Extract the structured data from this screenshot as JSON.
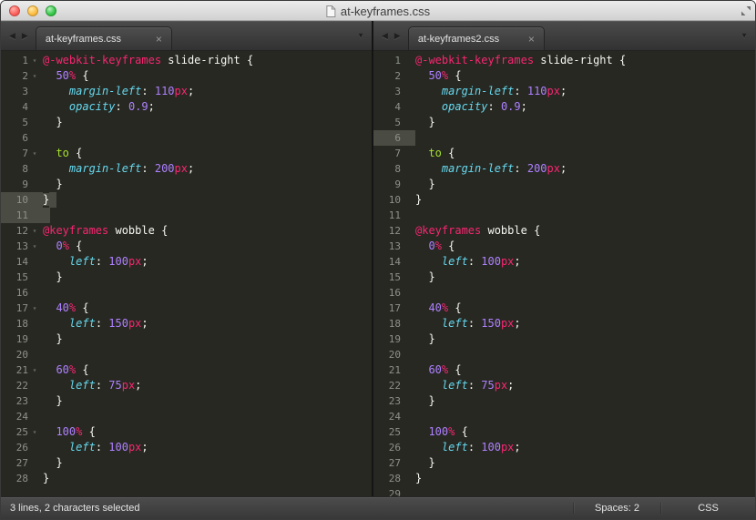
{
  "window": {
    "title": "at-keyframes.css"
  },
  "icons": {
    "tab_scroll_left": "◀",
    "tab_scroll_right": "▶",
    "tab_dropdown": "▼",
    "fold": "▾"
  },
  "colors": {
    "editor_background": "#272822",
    "foreground": "#f8f8f2",
    "at_rule_pink": "#f92672",
    "property_blue": "#66d9ef",
    "number_purple": "#ae81ff",
    "keyword_green": "#a6e22e",
    "gutter_gray": "#8f908a",
    "selection_gray": "#4a4b42"
  },
  "status_bar": {
    "selection_info": "3 lines, 2 characters selected",
    "indent": "Spaces: 2",
    "syntax": "CSS"
  },
  "panes": [
    {
      "tab": {
        "label": "at-keyframes.css",
        "close": "×"
      },
      "lines": [
        {
          "n": 1,
          "fold": true,
          "t": [
            [
              "at",
              "@-webkit-keyframes"
            ],
            [
              "plain",
              " "
            ],
            [
              "name",
              "slide-right"
            ],
            [
              "plain",
              " {"
            ]
          ]
        },
        {
          "n": 2,
          "fold": true,
          "t": [
            [
              "plain",
              "  "
            ],
            [
              "num",
              "50"
            ],
            [
              "unit",
              "%"
            ],
            [
              "plain",
              " {"
            ]
          ]
        },
        {
          "n": 3,
          "t": [
            [
              "plain",
              "    "
            ],
            [
              "prop",
              "margin-left"
            ],
            [
              "plain",
              ": "
            ],
            [
              "num",
              "110"
            ],
            [
              "unit",
              "px"
            ],
            [
              "plain",
              ";"
            ]
          ]
        },
        {
          "n": 4,
          "t": [
            [
              "plain",
              "    "
            ],
            [
              "prop",
              "opacity"
            ],
            [
              "plain",
              ": "
            ],
            [
              "num",
              "0.9"
            ],
            [
              "plain",
              ";"
            ]
          ]
        },
        {
          "n": 5,
          "t": [
            [
              "plain",
              "  }"
            ]
          ]
        },
        {
          "n": 6,
          "t": []
        },
        {
          "n": 7,
          "fold": true,
          "t": [
            [
              "plain",
              "  "
            ],
            [
              "kw",
              "to"
            ],
            [
              "plain",
              " {"
            ]
          ]
        },
        {
          "n": 8,
          "t": [
            [
              "plain",
              "    "
            ],
            [
              "prop",
              "margin-left"
            ],
            [
              "plain",
              ": "
            ],
            [
              "num",
              "200"
            ],
            [
              "unit",
              "px"
            ],
            [
              "plain",
              ";"
            ]
          ]
        },
        {
          "n": 9,
          "t": [
            [
              "plain",
              "  }"
            ]
          ]
        },
        {
          "n": 10,
          "ghl": true,
          "t": [
            [
              "sel",
              "}"
            ],
            [
              "selpad",
              ""
            ]
          ]
        },
        {
          "n": 11,
          "ghl": true,
          "t": [
            [
              "selpad",
              ""
            ]
          ]
        },
        {
          "n": 12,
          "fold": true,
          "t": [
            [
              "at",
              "@keyframes"
            ],
            [
              "plain",
              " "
            ],
            [
              "name",
              "wobble"
            ],
            [
              "plain",
              " {"
            ]
          ]
        },
        {
          "n": 13,
          "fold": true,
          "t": [
            [
              "plain",
              "  "
            ],
            [
              "num",
              "0"
            ],
            [
              "unit",
              "%"
            ],
            [
              "plain",
              " {"
            ]
          ]
        },
        {
          "n": 14,
          "t": [
            [
              "plain",
              "    "
            ],
            [
              "prop",
              "left"
            ],
            [
              "plain",
              ": "
            ],
            [
              "num",
              "100"
            ],
            [
              "unit",
              "px"
            ],
            [
              "plain",
              ";"
            ]
          ]
        },
        {
          "n": 15,
          "t": [
            [
              "plain",
              "  }"
            ]
          ]
        },
        {
          "n": 16,
          "t": []
        },
        {
          "n": 17,
          "fold": true,
          "t": [
            [
              "plain",
              "  "
            ],
            [
              "num",
              "40"
            ],
            [
              "unit",
              "%"
            ],
            [
              "plain",
              " {"
            ]
          ]
        },
        {
          "n": 18,
          "t": [
            [
              "plain",
              "    "
            ],
            [
              "prop",
              "left"
            ],
            [
              "plain",
              ": "
            ],
            [
              "num",
              "150"
            ],
            [
              "unit",
              "px"
            ],
            [
              "plain",
              ";"
            ]
          ]
        },
        {
          "n": 19,
          "t": [
            [
              "plain",
              "  }"
            ]
          ]
        },
        {
          "n": 20,
          "t": []
        },
        {
          "n": 21,
          "fold": true,
          "t": [
            [
              "plain",
              "  "
            ],
            [
              "num",
              "60"
            ],
            [
              "unit",
              "%"
            ],
            [
              "plain",
              " {"
            ]
          ]
        },
        {
          "n": 22,
          "t": [
            [
              "plain",
              "    "
            ],
            [
              "prop",
              "left"
            ],
            [
              "plain",
              ": "
            ],
            [
              "num",
              "75"
            ],
            [
              "unit",
              "px"
            ],
            [
              "plain",
              ";"
            ]
          ]
        },
        {
          "n": 23,
          "t": [
            [
              "plain",
              "  }"
            ]
          ]
        },
        {
          "n": 24,
          "t": []
        },
        {
          "n": 25,
          "fold": true,
          "t": [
            [
              "plain",
              "  "
            ],
            [
              "num",
              "100"
            ],
            [
              "unit",
              "%"
            ],
            [
              "plain",
              " {"
            ]
          ]
        },
        {
          "n": 26,
          "t": [
            [
              "plain",
              "    "
            ],
            [
              "prop",
              "left"
            ],
            [
              "plain",
              ": "
            ],
            [
              "num",
              "100"
            ],
            [
              "unit",
              "px"
            ],
            [
              "plain",
              ";"
            ]
          ]
        },
        {
          "n": 27,
          "t": [
            [
              "plain",
              "  }"
            ]
          ]
        },
        {
          "n": 28,
          "t": [
            [
              "plain",
              "}"
            ]
          ]
        }
      ]
    },
    {
      "tab": {
        "label": "at-keyframes2.css",
        "close": "×"
      },
      "lines": [
        {
          "n": 1,
          "t": [
            [
              "at",
              "@-webkit-keyframes"
            ],
            [
              "plain",
              " "
            ],
            [
              "name",
              "slide-right"
            ],
            [
              "plain",
              " {"
            ]
          ]
        },
        {
          "n": 2,
          "t": [
            [
              "plain",
              "  "
            ],
            [
              "num",
              "50"
            ],
            [
              "unit",
              "%"
            ],
            [
              "plain",
              " {"
            ]
          ]
        },
        {
          "n": 3,
          "t": [
            [
              "plain",
              "    "
            ],
            [
              "prop",
              "margin-left"
            ],
            [
              "plain",
              ": "
            ],
            [
              "num",
              "110"
            ],
            [
              "unit",
              "px"
            ],
            [
              "plain",
              ";"
            ]
          ]
        },
        {
          "n": 4,
          "t": [
            [
              "plain",
              "    "
            ],
            [
              "prop",
              "opacity"
            ],
            [
              "plain",
              ": "
            ],
            [
              "num",
              "0.9"
            ],
            [
              "plain",
              ";"
            ]
          ]
        },
        {
          "n": 5,
          "t": [
            [
              "plain",
              "  }"
            ]
          ]
        },
        {
          "n": 6,
          "ghl": true,
          "t": []
        },
        {
          "n": 7,
          "t": [
            [
              "plain",
              "  "
            ],
            [
              "kw",
              "to"
            ],
            [
              "plain",
              " {"
            ]
          ]
        },
        {
          "n": 8,
          "t": [
            [
              "plain",
              "    "
            ],
            [
              "prop",
              "margin-left"
            ],
            [
              "plain",
              ": "
            ],
            [
              "num",
              "200"
            ],
            [
              "unit",
              "px"
            ],
            [
              "plain",
              ";"
            ]
          ]
        },
        {
          "n": 9,
          "t": [
            [
              "plain",
              "  }"
            ]
          ]
        },
        {
          "n": 10,
          "t": [
            [
              "plain",
              "}"
            ]
          ]
        },
        {
          "n": 11,
          "t": []
        },
        {
          "n": 12,
          "t": [
            [
              "at",
              "@keyframes"
            ],
            [
              "plain",
              " "
            ],
            [
              "name",
              "wobble"
            ],
            [
              "plain",
              " {"
            ]
          ]
        },
        {
          "n": 13,
          "t": [
            [
              "plain",
              "  "
            ],
            [
              "num",
              "0"
            ],
            [
              "unit",
              "%"
            ],
            [
              "plain",
              " {"
            ]
          ]
        },
        {
          "n": 14,
          "t": [
            [
              "plain",
              "    "
            ],
            [
              "prop",
              "left"
            ],
            [
              "plain",
              ": "
            ],
            [
              "num",
              "100"
            ],
            [
              "unit",
              "px"
            ],
            [
              "plain",
              ";"
            ]
          ]
        },
        {
          "n": 15,
          "t": [
            [
              "plain",
              "  }"
            ]
          ]
        },
        {
          "n": 16,
          "t": []
        },
        {
          "n": 17,
          "t": [
            [
              "plain",
              "  "
            ],
            [
              "num",
              "40"
            ],
            [
              "unit",
              "%"
            ],
            [
              "plain",
              " {"
            ]
          ]
        },
        {
          "n": 18,
          "t": [
            [
              "plain",
              "    "
            ],
            [
              "prop",
              "left"
            ],
            [
              "plain",
              ": "
            ],
            [
              "num",
              "150"
            ],
            [
              "unit",
              "px"
            ],
            [
              "plain",
              ";"
            ]
          ]
        },
        {
          "n": 19,
          "t": [
            [
              "plain",
              "  }"
            ]
          ]
        },
        {
          "n": 20,
          "t": []
        },
        {
          "n": 21,
          "t": [
            [
              "plain",
              "  "
            ],
            [
              "num",
              "60"
            ],
            [
              "unit",
              "%"
            ],
            [
              "plain",
              " {"
            ]
          ]
        },
        {
          "n": 22,
          "t": [
            [
              "plain",
              "    "
            ],
            [
              "prop",
              "left"
            ],
            [
              "plain",
              ": "
            ],
            [
              "num",
              "75"
            ],
            [
              "unit",
              "px"
            ],
            [
              "plain",
              ";"
            ]
          ]
        },
        {
          "n": 23,
          "t": [
            [
              "plain",
              "  }"
            ]
          ]
        },
        {
          "n": 24,
          "t": []
        },
        {
          "n": 25,
          "t": [
            [
              "plain",
              "  "
            ],
            [
              "num",
              "100"
            ],
            [
              "unit",
              "%"
            ],
            [
              "plain",
              " {"
            ]
          ]
        },
        {
          "n": 26,
          "t": [
            [
              "plain",
              "    "
            ],
            [
              "prop",
              "left"
            ],
            [
              "plain",
              ": "
            ],
            [
              "num",
              "100"
            ],
            [
              "unit",
              "px"
            ],
            [
              "plain",
              ";"
            ]
          ]
        },
        {
          "n": 27,
          "t": [
            [
              "plain",
              "  }"
            ]
          ]
        },
        {
          "n": 28,
          "t": [
            [
              "plain",
              "}"
            ]
          ]
        },
        {
          "n": 29,
          "t": []
        }
      ]
    }
  ]
}
